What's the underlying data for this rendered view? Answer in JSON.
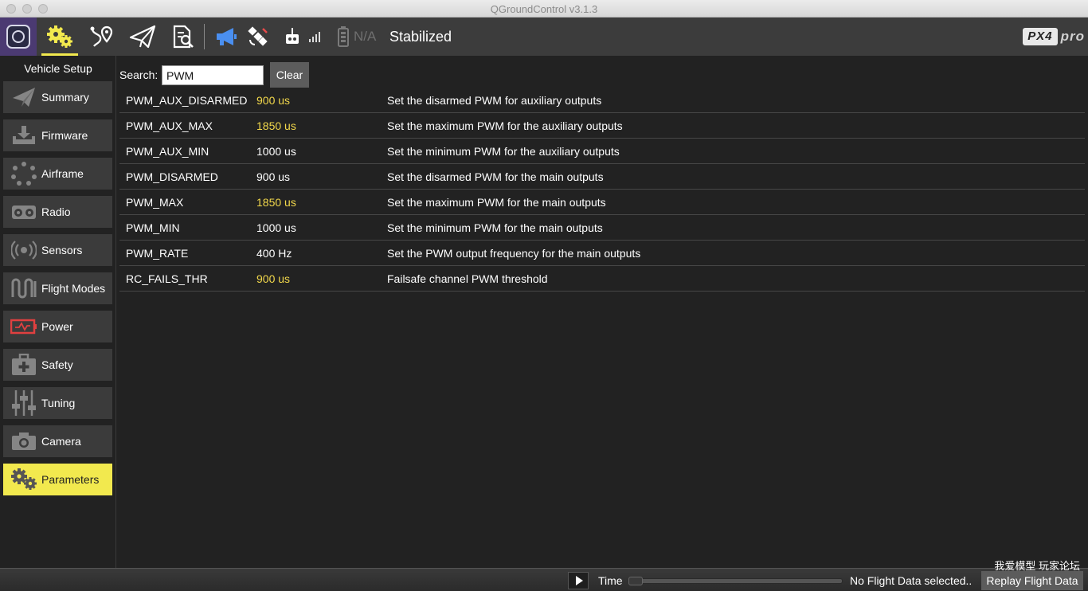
{
  "window": {
    "title": "QGroundControl v3.1.3"
  },
  "toolbar": {
    "battery_text": "N/A",
    "flight_mode": "Stabilized",
    "brand": {
      "logo": "PX4",
      "suffix": "pro"
    },
    "accent_color": "#f2e94e"
  },
  "sidebar": {
    "header": "Vehicle Setup",
    "items": [
      {
        "label": "Summary",
        "icon": "paper-plane-icon"
      },
      {
        "label": "Firmware",
        "icon": "download-icon"
      },
      {
        "label": "Airframe",
        "icon": "airframe-icon"
      },
      {
        "label": "Radio",
        "icon": "radio-icon"
      },
      {
        "label": "Sensors",
        "icon": "sensors-icon"
      },
      {
        "label": "Flight Modes",
        "icon": "flight-modes-icon"
      },
      {
        "label": "Power",
        "icon": "battery-icon"
      },
      {
        "label": "Safety",
        "icon": "first-aid-icon"
      },
      {
        "label": "Tuning",
        "icon": "sliders-icon"
      },
      {
        "label": "Camera",
        "icon": "camera-icon"
      },
      {
        "label": "Parameters",
        "icon": "gears-icon",
        "active": true
      }
    ]
  },
  "search": {
    "label": "Search:",
    "value": "PWM",
    "clear_label": "Clear"
  },
  "parameters": [
    {
      "name": "PWM_AUX_DISARMED",
      "value": "900 us",
      "modified": true,
      "description": "Set the disarmed PWM for auxiliary outputs"
    },
    {
      "name": "PWM_AUX_MAX",
      "value": "1850 us",
      "modified": true,
      "description": "Set the maximum PWM for the auxiliary outputs"
    },
    {
      "name": "PWM_AUX_MIN",
      "value": "1000 us",
      "modified": false,
      "description": "Set the minimum PWM for the auxiliary outputs"
    },
    {
      "name": "PWM_DISARMED",
      "value": "900 us",
      "modified": false,
      "description": "Set the disarmed PWM for the main outputs"
    },
    {
      "name": "PWM_MAX",
      "value": "1850 us",
      "modified": true,
      "description": "Set the maximum PWM for the main outputs"
    },
    {
      "name": "PWM_MIN",
      "value": "1000 us",
      "modified": false,
      "description": "Set the minimum PWM for the main outputs"
    },
    {
      "name": "PWM_RATE",
      "value": "400 Hz",
      "modified": false,
      "description": "Set the PWM output frequency for the main outputs"
    },
    {
      "name": "RC_FAILS_THR",
      "value": "900 us",
      "modified": true,
      "description": "Failsafe channel PWM threshold"
    }
  ],
  "bottombar": {
    "time_label": "Time",
    "status": "No Flight Data selected..",
    "replay_label": "Replay Flight Data"
  },
  "watermark": "我爱模型 玩家论坛"
}
